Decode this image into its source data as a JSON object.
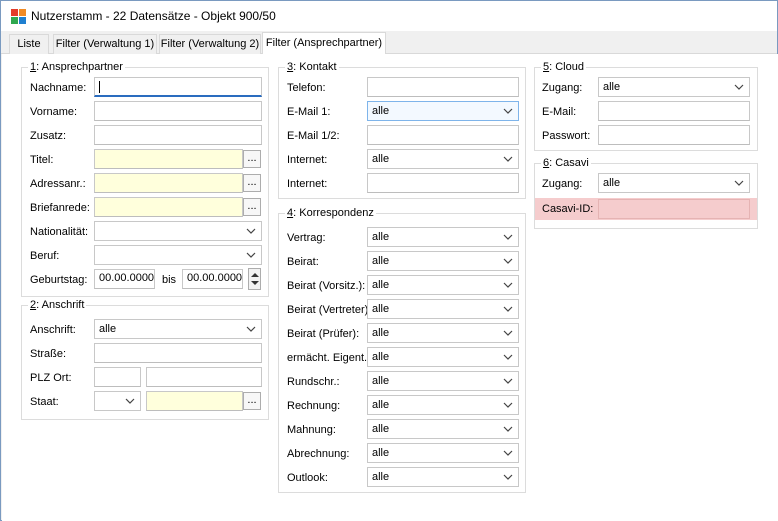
{
  "window": {
    "title": "Nutzerstamm - 22 Datensätze - Objekt 900/50",
    "icon": "app-logo-icon"
  },
  "tabs": [
    {
      "label": "Liste"
    },
    {
      "label": "Filter (Verwaltung 1)"
    },
    {
      "label": "Filter (Verwaltung 2)"
    },
    {
      "label": "Filter (Ansprechpartner)",
      "active": true
    }
  ],
  "ansprechpartner": {
    "num": "1",
    "title": ": Ansprechpartner",
    "nachname_label": "Nachname:",
    "nachname_value": "",
    "vorname_label": "Vorname:",
    "zusatz_label": "Zusatz:",
    "titel_label": "Titel:",
    "adressanr_label": "Adressanr.:",
    "briefanrede_label": "Briefanrede:",
    "nationalitaet_label": "Nationalität:",
    "beruf_label": "Beruf:",
    "geburtstag_label": "Geburtstag:",
    "geburtstag_from": "00.00.0000",
    "bis_label": "bis",
    "geburtstag_to": "00.00.0000",
    "dots": "..."
  },
  "anschrift": {
    "num": "2",
    "title": ": Anschrift",
    "anschrift_label": "Anschrift:",
    "anschrift_value": "alle",
    "strasse_label": "Straße:",
    "plzort_label": "PLZ Ort:",
    "staat_label": "Staat:",
    "dots": "..."
  },
  "kontakt": {
    "num": "3",
    "title": ": Kontakt",
    "telefon_label": "Telefon:",
    "email1_label": "E-Mail 1:",
    "email1_value": "alle",
    "email12_label": "E-Mail 1/2:",
    "internet1_label": "Internet:",
    "internet1_value": "alle",
    "internet2_label": "Internet:"
  },
  "korrespondenz": {
    "num": "4",
    "title": ": Korrespondenz",
    "rows": [
      {
        "label": "Vertrag:",
        "value": "alle"
      },
      {
        "label": "Beirat:",
        "value": "alle"
      },
      {
        "label": "Beirat (Vorsitz.):",
        "value": "alle"
      },
      {
        "label": "Beirat (Vertreter):",
        "value": "alle"
      },
      {
        "label": "Beirat (Prüfer):",
        "value": "alle"
      },
      {
        "label": "ermächt. Eigent.:",
        "value": "alle"
      },
      {
        "label": "Rundschr.:",
        "value": "alle"
      },
      {
        "label": "Rechnung:",
        "value": "alle"
      },
      {
        "label": "Mahnung:",
        "value": "alle"
      },
      {
        "label": "Abrechnung:",
        "value": "alle"
      },
      {
        "label": "Outlook:",
        "value": "alle"
      }
    ]
  },
  "cloud": {
    "num": "5",
    "title": ": Cloud",
    "zugang_label": "Zugang:",
    "zugang_value": "alle",
    "email_label": "E-Mail:",
    "passwort_label": "Passwort:"
  },
  "casavi": {
    "num": "6",
    "title": ": Casavi",
    "zugang_label": "Zugang:",
    "zugang_value": "alle",
    "id_label": "Casavi-ID:"
  },
  "colors": {
    "yellow_field": "#ffffdc",
    "highlight": "#f5cccd",
    "focus": "#2a6cbf"
  }
}
